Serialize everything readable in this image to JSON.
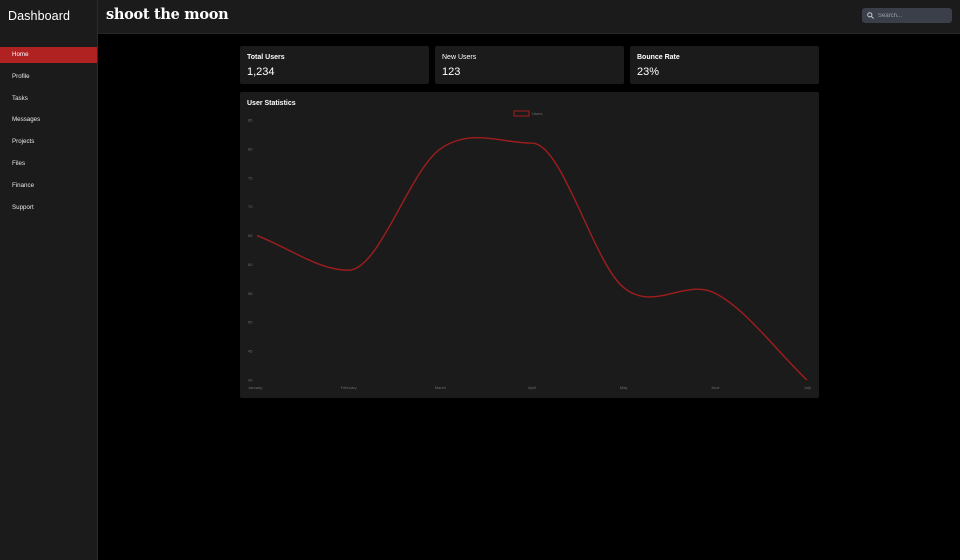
{
  "sidebar": {
    "title": "Dashboard",
    "items": [
      {
        "label": "Home",
        "active": true
      },
      {
        "label": "Profile"
      },
      {
        "label": "Tasks"
      },
      {
        "label": "Messages"
      },
      {
        "label": "Projects"
      },
      {
        "label": "Files"
      },
      {
        "label": "Finance"
      },
      {
        "label": "Support"
      }
    ]
  },
  "header": {
    "logo": "shoot the moon",
    "search": {
      "placeholder": "Search..."
    }
  },
  "stats": [
    {
      "title": "Total Users",
      "value": "1,234"
    },
    {
      "title": "New Users",
      "value": "123"
    },
    {
      "title": "Bounce Rate",
      "value": "23%"
    }
  ],
  "colors": {
    "accent": "#b02121",
    "line": "#a01d1d",
    "panel": "#1b1b1b",
    "background": "#000000"
  },
  "chart": {
    "title": "User Statistics",
    "chart_data": {
      "type": "line",
      "categories": [
        "January",
        "February",
        "March",
        "April",
        "May",
        "June",
        "July"
      ],
      "series": [
        {
          "name": "Users",
          "values": [
            65,
            59,
            80,
            81,
            56,
            55,
            40
          ]
        }
      ],
      "ylim": [
        40,
        85
      ],
      "yticks": [
        40,
        45,
        50,
        55,
        60,
        65,
        70,
        75,
        80,
        85
      ],
      "grid": false,
      "legend": "top-center"
    }
  }
}
